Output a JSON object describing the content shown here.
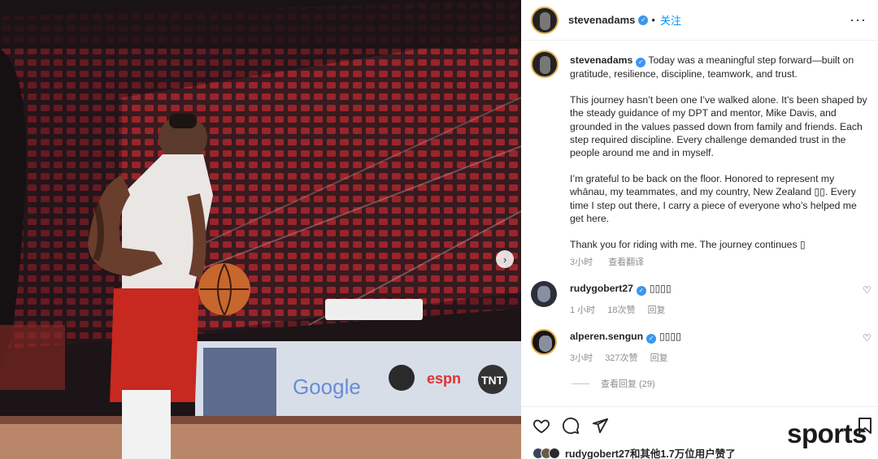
{
  "post": {
    "username": "stevenadams",
    "follow_label": "关注",
    "more_label": "···",
    "caption_paragraphs": [
      "Today was a meaningful step forward—built on gratitude, resilience, discipline, teamwork, and trust.",
      "This journey hasn’t been one I’ve walked alone. It’s been shaped by the steady guidance of my DPT and mentor, Mike Davis, and grounded in the values passed down from family and friends. Each step required discipline. Every challenge demanded trust in the people around me and in myself.",
      "I’m grateful to be back on the floor. Honored to represent my whānau, my teammates, and my country, New Zealand ▯▯. Every time I step out there, I carry a piece of everyone who’s helped me get here.",
      "Thank you for riding with me. The journey continues ▯"
    ],
    "caption_time": "3小时",
    "see_translation": "查看翻译"
  },
  "comments": [
    {
      "username": "rudygobert27",
      "text": "▯▯▯▯",
      "time": "1 小时",
      "likes": "18次赞",
      "reply": "回复"
    },
    {
      "username": "alperen.sengun",
      "text": "▯▯▯▯",
      "time": "3小时",
      "likes": "327次赞",
      "reply": "回复"
    }
  ],
  "view_replies": "查看回复 (29)",
  "likes_summary": "rudygobert27和其他1.7万位用户赞了",
  "watermark": "sports",
  "icons": {
    "like": "heart-icon",
    "comment": "comment-icon",
    "share": "send-icon",
    "save": "bookmark-icon",
    "next": "chevron-right-icon",
    "verified": "verified-badge-icon"
  }
}
